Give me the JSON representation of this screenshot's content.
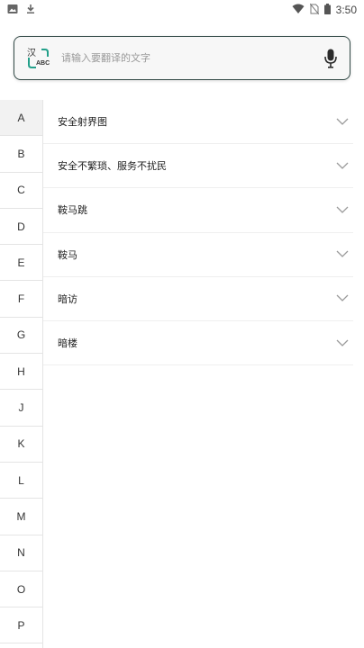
{
  "status_bar": {
    "time": "3:50",
    "icons": [
      "image-icon",
      "download-icon",
      "wifi-icon",
      "no-sim-icon",
      "battery-icon"
    ]
  },
  "search": {
    "placeholder": "请输入要翻译的文字",
    "logo_text": "汉",
    "logo_subtext": "ABC"
  },
  "alphabet": [
    "A",
    "B",
    "C",
    "D",
    "E",
    "F",
    "G",
    "H",
    "J",
    "K",
    "L",
    "M",
    "N",
    "O",
    "P"
  ],
  "active_letter": "A",
  "words": [
    "安全射界图",
    "安全不繁琐、服务不扰民",
    "鞍马跳",
    "鞍马",
    "暗访",
    "暗楼"
  ],
  "colors": {
    "accent": "#23a08a",
    "border": "#334a47"
  }
}
